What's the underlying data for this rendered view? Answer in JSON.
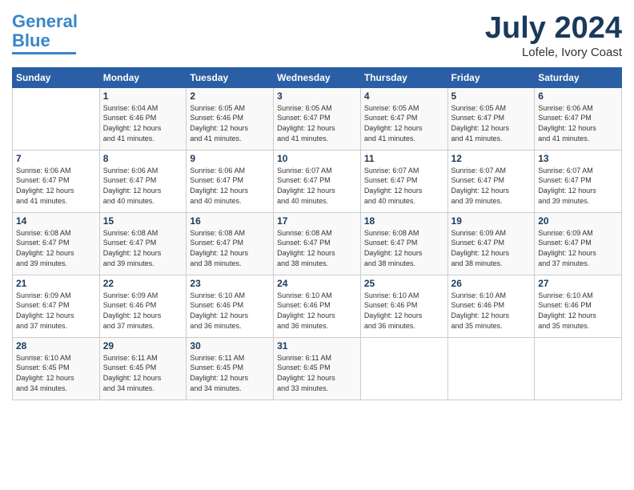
{
  "header": {
    "logo_line1": "General",
    "logo_line2": "Blue",
    "month": "July 2024",
    "location": "Lofele, Ivory Coast"
  },
  "weekdays": [
    "Sunday",
    "Monday",
    "Tuesday",
    "Wednesday",
    "Thursday",
    "Friday",
    "Saturday"
  ],
  "days": [
    {
      "date": "",
      "info": ""
    },
    {
      "date": "1",
      "info": "Sunrise: 6:04 AM\nSunset: 6:46 PM\nDaylight: 12 hours\nand 41 minutes."
    },
    {
      "date": "2",
      "info": "Sunrise: 6:05 AM\nSunset: 6:46 PM\nDaylight: 12 hours\nand 41 minutes."
    },
    {
      "date": "3",
      "info": "Sunrise: 6:05 AM\nSunset: 6:47 PM\nDaylight: 12 hours\nand 41 minutes."
    },
    {
      "date": "4",
      "info": "Sunrise: 6:05 AM\nSunset: 6:47 PM\nDaylight: 12 hours\nand 41 minutes."
    },
    {
      "date": "5",
      "info": "Sunrise: 6:05 AM\nSunset: 6:47 PM\nDaylight: 12 hours\nand 41 minutes."
    },
    {
      "date": "6",
      "info": "Sunrise: 6:06 AM\nSunset: 6:47 PM\nDaylight: 12 hours\nand 41 minutes."
    },
    {
      "date": "7",
      "info": "Sunrise: 6:06 AM\nSunset: 6:47 PM\nDaylight: 12 hours\nand 41 minutes."
    },
    {
      "date": "8",
      "info": "Sunrise: 6:06 AM\nSunset: 6:47 PM\nDaylight: 12 hours\nand 40 minutes."
    },
    {
      "date": "9",
      "info": "Sunrise: 6:06 AM\nSunset: 6:47 PM\nDaylight: 12 hours\nand 40 minutes."
    },
    {
      "date": "10",
      "info": "Sunrise: 6:07 AM\nSunset: 6:47 PM\nDaylight: 12 hours\nand 40 minutes."
    },
    {
      "date": "11",
      "info": "Sunrise: 6:07 AM\nSunset: 6:47 PM\nDaylight: 12 hours\nand 40 minutes."
    },
    {
      "date": "12",
      "info": "Sunrise: 6:07 AM\nSunset: 6:47 PM\nDaylight: 12 hours\nand 39 minutes."
    },
    {
      "date": "13",
      "info": "Sunrise: 6:07 AM\nSunset: 6:47 PM\nDaylight: 12 hours\nand 39 minutes."
    },
    {
      "date": "14",
      "info": "Sunrise: 6:08 AM\nSunset: 6:47 PM\nDaylight: 12 hours\nand 39 minutes."
    },
    {
      "date": "15",
      "info": "Sunrise: 6:08 AM\nSunset: 6:47 PM\nDaylight: 12 hours\nand 39 minutes."
    },
    {
      "date": "16",
      "info": "Sunrise: 6:08 AM\nSunset: 6:47 PM\nDaylight: 12 hours\nand 38 minutes."
    },
    {
      "date": "17",
      "info": "Sunrise: 6:08 AM\nSunset: 6:47 PM\nDaylight: 12 hours\nand 38 minutes."
    },
    {
      "date": "18",
      "info": "Sunrise: 6:08 AM\nSunset: 6:47 PM\nDaylight: 12 hours\nand 38 minutes."
    },
    {
      "date": "19",
      "info": "Sunrise: 6:09 AM\nSunset: 6:47 PM\nDaylight: 12 hours\nand 38 minutes."
    },
    {
      "date": "20",
      "info": "Sunrise: 6:09 AM\nSunset: 6:47 PM\nDaylight: 12 hours\nand 37 minutes."
    },
    {
      "date": "21",
      "info": "Sunrise: 6:09 AM\nSunset: 6:47 PM\nDaylight: 12 hours\nand 37 minutes."
    },
    {
      "date": "22",
      "info": "Sunrise: 6:09 AM\nSunset: 6:46 PM\nDaylight: 12 hours\nand 37 minutes."
    },
    {
      "date": "23",
      "info": "Sunrise: 6:10 AM\nSunset: 6:46 PM\nDaylight: 12 hours\nand 36 minutes."
    },
    {
      "date": "24",
      "info": "Sunrise: 6:10 AM\nSunset: 6:46 PM\nDaylight: 12 hours\nand 36 minutes."
    },
    {
      "date": "25",
      "info": "Sunrise: 6:10 AM\nSunset: 6:46 PM\nDaylight: 12 hours\nand 36 minutes."
    },
    {
      "date": "26",
      "info": "Sunrise: 6:10 AM\nSunset: 6:46 PM\nDaylight: 12 hours\nand 35 minutes."
    },
    {
      "date": "27",
      "info": "Sunrise: 6:10 AM\nSunset: 6:46 PM\nDaylight: 12 hours\nand 35 minutes."
    },
    {
      "date": "28",
      "info": "Sunrise: 6:10 AM\nSunset: 6:45 PM\nDaylight: 12 hours\nand 34 minutes."
    },
    {
      "date": "29",
      "info": "Sunrise: 6:11 AM\nSunset: 6:45 PM\nDaylight: 12 hours\nand 34 minutes."
    },
    {
      "date": "30",
      "info": "Sunrise: 6:11 AM\nSunset: 6:45 PM\nDaylight: 12 hours\nand 34 minutes."
    },
    {
      "date": "31",
      "info": "Sunrise: 6:11 AM\nSunset: 6:45 PM\nDaylight: 12 hours\nand 33 minutes."
    }
  ]
}
